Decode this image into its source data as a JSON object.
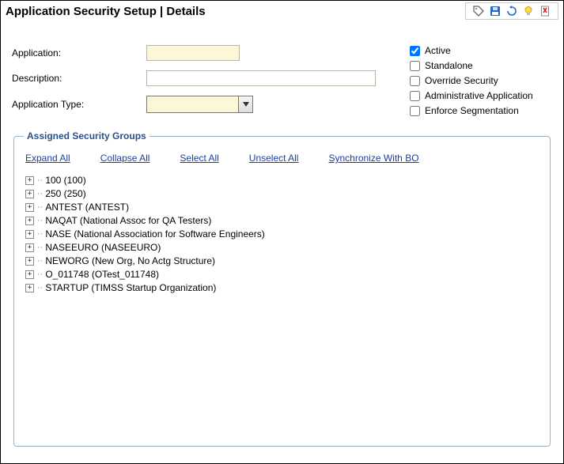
{
  "header": {
    "title": "Application Security Setup  |  Details"
  },
  "form": {
    "labels": {
      "application": "Application:",
      "description": "Description:",
      "application_type": "Application Type:"
    },
    "values": {
      "application": "",
      "description": "",
      "application_type": ""
    }
  },
  "checkboxes": {
    "active": {
      "label": "Active",
      "checked": true
    },
    "standalone": {
      "label": "Standalone",
      "checked": false
    },
    "override_security": {
      "label": "Override Security",
      "checked": false
    },
    "administrative_application": {
      "label": "Administrative Application",
      "checked": false
    },
    "enforce_segmentation": {
      "label": "Enforce Segmentation",
      "checked": false
    }
  },
  "groups": {
    "legend": "Assigned Security Groups",
    "links": {
      "expand_all": "Expand All",
      "collapse_all": "Collapse All",
      "select_all": "Select All",
      "unselect_all": "Unselect All",
      "sync": "Synchronize With BO"
    },
    "items": [
      {
        "label": "100 (100)"
      },
      {
        "label": "250 (250)"
      },
      {
        "label": "ANTEST (ANTEST)"
      },
      {
        "label": "NAQAT (National Assoc for QA Testers)"
      },
      {
        "label": "NASE (National Association for Software Engineers)"
      },
      {
        "label": "NASEEURO (NASEEURO)"
      },
      {
        "label": "NEWORG (New Org, No Actg Structure)"
      },
      {
        "label": "O_011748 (OTest_011748)"
      },
      {
        "label": "STARTUP (TIMSS Startup Organization)"
      }
    ]
  }
}
